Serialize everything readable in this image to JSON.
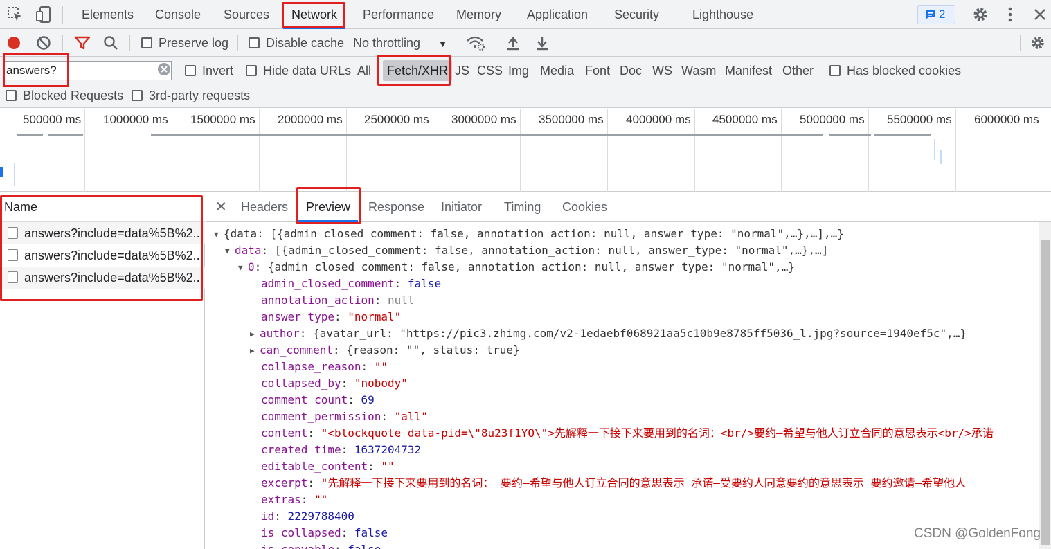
{
  "tabs": [
    "Elements",
    "Console",
    "Sources",
    "Network",
    "Performance",
    "Memory",
    "Application",
    "Security",
    "Lighthouse"
  ],
  "active_tab": "Network",
  "issues_count": "2",
  "toolbar": {
    "preserve_log": "Preserve log",
    "disable_cache": "Disable cache",
    "throttling": "No throttling"
  },
  "filter": {
    "value": "answers?",
    "invert": "Invert",
    "hide_data_urls": "Hide data URLs",
    "types": [
      "All",
      "Fetch/XHR",
      "JS",
      "CSS",
      "Img",
      "Media",
      "Font",
      "Doc",
      "WS",
      "Wasm",
      "Manifest",
      "Other"
    ],
    "active_type": "Fetch/XHR",
    "has_blocked_cookies": "Has blocked cookies",
    "blocked_requests": "Blocked Requests",
    "third_party": "3rd-party requests"
  },
  "overview_ticks": [
    "500000 ms",
    "1000000 ms",
    "1500000 ms",
    "2000000 ms",
    "2500000 ms",
    "3000000 ms",
    "3500000 ms",
    "4000000 ms",
    "4500000 ms",
    "5000000 ms",
    "5500000 ms",
    "6000000 ms"
  ],
  "requests": {
    "header": "Name",
    "rows": [
      "answers?include=data%5B%2...",
      "answers?include=data%5B%2...",
      "answers?include=data%5B%2..."
    ]
  },
  "detail_tabs": [
    "Headers",
    "Preview",
    "Response",
    "Initiator",
    "Timing",
    "Cookies"
  ],
  "active_detail_tab": "Preview",
  "preview": {
    "root_summary": "{data: [{admin_closed_comment: false, annotation_action: null, answer_type: \"normal\",…},…],…}",
    "data_key": "data",
    "data_summary": "[{admin_closed_comment: false, annotation_action: null, answer_type: \"normal\",…},…]",
    "item_key": "0",
    "item_summary": "{admin_closed_comment: false, annotation_action: null, answer_type: \"normal\",…}",
    "fields": [
      {
        "key": "admin_closed_comment",
        "value": "false",
        "type": "bool"
      },
      {
        "key": "annotation_action",
        "value": "null",
        "type": "null"
      },
      {
        "key": "answer_type",
        "value": "\"normal\"",
        "type": "str"
      },
      {
        "key": "author",
        "value": "{avatar_url: \"https://pic3.zhimg.com/v2-1edaebf068921aa5c10b9e8785ff5036_l.jpg?source=1940ef5c\",…}",
        "type": "obj"
      },
      {
        "key": "can_comment",
        "value": "{reason: \"\", status: true}",
        "type": "obj"
      },
      {
        "key": "collapse_reason",
        "value": "\"\"",
        "type": "str"
      },
      {
        "key": "collapsed_by",
        "value": "\"nobody\"",
        "type": "str"
      },
      {
        "key": "comment_count",
        "value": "69",
        "type": "num"
      },
      {
        "key": "comment_permission",
        "value": "\"all\"",
        "type": "str"
      },
      {
        "key": "content",
        "value": "\"<blockquote data-pid=\\\"8u23f1YO\\\">先解释一下接下来要用到的名词：<br/>要约—希望与他人订立合同的意思表示<br/>承诺",
        "type": "str"
      },
      {
        "key": "created_time",
        "value": "1637204732",
        "type": "num"
      },
      {
        "key": "editable_content",
        "value": "\"\"",
        "type": "str"
      },
      {
        "key": "excerpt",
        "value": "\"先解释一下接下来要用到的名词： 要约—希望与他人订立合同的意思表示 承诺—受要约人同意要约的意思表示 要约邀请—希望他人",
        "type": "str"
      },
      {
        "key": "extras",
        "value": "\"\"",
        "type": "str"
      },
      {
        "key": "id",
        "value": "2229788400",
        "type": "num"
      },
      {
        "key": "is_collapsed",
        "value": "false",
        "type": "bool"
      },
      {
        "key": "is_copyable",
        "value": "false",
        "type": "bool"
      }
    ]
  },
  "watermark": "CSDN @GoldenFong",
  "colors": {
    "accent": "#1a73e8",
    "annotation": "#e02020",
    "record": "#d93025"
  }
}
